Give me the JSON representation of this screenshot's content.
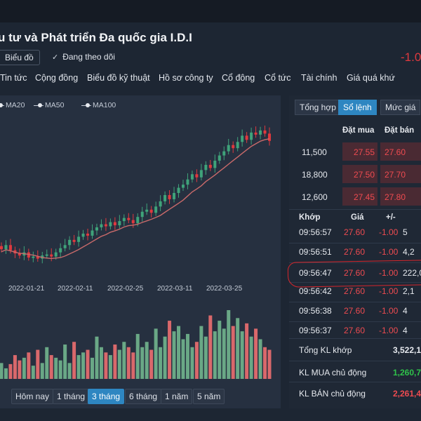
{
  "header": {
    "title": "u tư và Phát triển Đa quốc gia I.D.I",
    "chart_button": "Biểu đồ",
    "follow_label": "Đang theo dõi",
    "price_change": "-1.0"
  },
  "nav": {
    "tabs": [
      "Tin tức",
      "Cộng đồng",
      "Biểu đồ kỹ thuật",
      "Hồ sơ công ty",
      "Cổ đông",
      "Cổ tức",
      "Tài chính",
      "Giá quá khứ"
    ]
  },
  "chart": {
    "legend": [
      "MA20",
      "MA50",
      "MA100"
    ],
    "x_labels": [
      "2022-01-21",
      "2022-02-11",
      "2022-02-25",
      "2022-03-11",
      "2022-03-25"
    ],
    "periods": [
      "Hôm nay",
      "1 tháng",
      "3 tháng",
      "6 tháng",
      "1 năm",
      "5 năm"
    ],
    "active_period": "3 tháng",
    "colors": {
      "up": "#3fa37a",
      "down": "#e0393e",
      "ma": "#c96a6a",
      "vol_up": "#6aa886",
      "vol_down": "#d9686b"
    }
  },
  "chart_data": {
    "type": "candlestick",
    "x_tick_labels": [
      "2022-01-21",
      "2022-02-11",
      "2022-02-25",
      "2022-03-11",
      "2022-03-25"
    ],
    "series": [
      "MA20",
      "MA50",
      "MA100"
    ],
    "close": [
      17.2,
      17.6,
      17.1,
      16.8,
      16.6,
      16.9,
      16.4,
      16.5,
      16.3,
      16.6,
      16.7,
      16.5,
      16.9,
      17.3,
      17.6,
      18.1,
      17.9,
      18.4,
      18.7,
      18.5,
      19.0,
      19.3,
      19.6,
      19.4,
      19.8,
      19.5,
      19.9,
      20.2,
      20.0,
      19.7,
      20.3,
      20.8,
      21.0,
      20.7,
      21.3,
      21.8,
      22.4,
      22.0,
      22.6,
      23.1,
      23.4,
      23.9,
      24.4,
      24.1,
      24.8,
      25.3,
      25.0,
      25.7,
      26.2,
      26.6,
      27.2,
      26.9,
      27.5,
      28.1,
      27.7,
      28.4,
      28.2,
      28.6,
      28.3,
      27.6
    ],
    "volume": [
      30,
      20,
      28,
      45,
      35,
      40,
      50,
      25,
      55,
      30,
      60,
      45,
      40,
      35,
      65,
      30,
      70,
      45,
      50,
      55,
      40,
      80,
      60,
      50,
      45,
      65,
      55,
      70,
      60,
      50,
      85,
      60,
      70,
      55,
      95,
      60,
      80,
      110,
      90,
      100,
      75,
      85,
      60,
      70,
      100,
      80,
      120,
      90,
      110,
      95,
      130,
      100,
      115,
      90,
      105,
      80,
      95,
      75,
      60,
      55
    ]
  },
  "right": {
    "tabs": [
      "Tổng hợp",
      "Sổ lệnh",
      "Mức giá"
    ],
    "active_tab": "Sổ lệnh",
    "orderbook_headers": {
      "bid": "Đặt mua",
      "ask": "Đặt bán"
    },
    "orderbook": [
      {
        "volume": "11,500",
        "bid": "27.55",
        "ask": "27.60"
      },
      {
        "volume": "18,800",
        "bid": "27.50",
        "ask": "27.70"
      },
      {
        "volume": "12,600",
        "bid": "27.45",
        "ask": "27.80"
      }
    ],
    "trade_headers": {
      "time": "Khớp",
      "price": "Giá",
      "change": "+/-"
    },
    "trades": [
      {
        "time": "09:56:57",
        "price": "27.60",
        "change": "-1.00",
        "volume": "5"
      },
      {
        "time": "09:56:51",
        "price": "27.60",
        "change": "-1.00",
        "volume": "4,2"
      },
      {
        "time": "09:56:47",
        "price": "27.60",
        "change": "-1.00",
        "volume": "222,0"
      },
      {
        "time": "09:56:42",
        "price": "27.60",
        "change": "-1.00",
        "volume": "2,1"
      },
      {
        "time": "09:56:38",
        "price": "27.60",
        "change": "-1.00",
        "volume": "4"
      },
      {
        "time": "09:56:37",
        "price": "27.60",
        "change": "-1.00",
        "volume": "4"
      }
    ],
    "summary": [
      {
        "label": "Tổng KL khớp",
        "value": "3,522,1",
        "color": "#e6e9ee"
      },
      {
        "label": "KL MUA chủ động",
        "value": "1,260,7",
        "color": "#2fc34a"
      },
      {
        "label": "KL BÁN chủ động",
        "value": "2,261,4",
        "color": "#ee4b50"
      }
    ]
  }
}
